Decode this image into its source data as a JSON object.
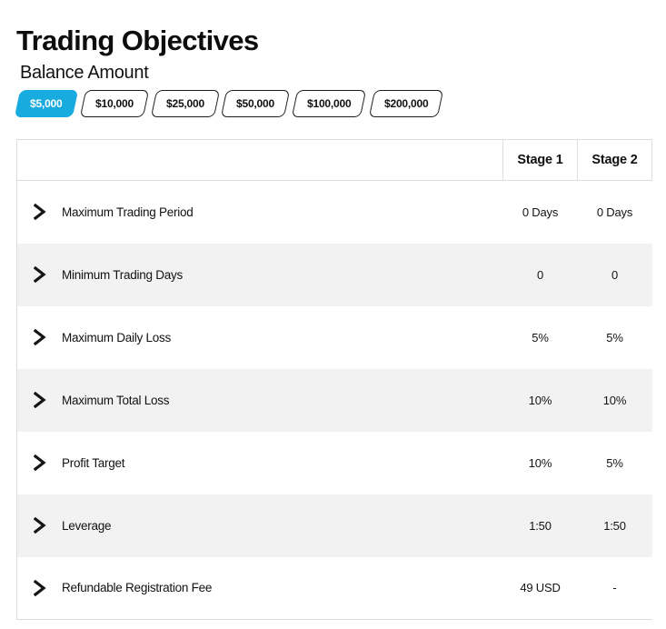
{
  "header": {
    "title": "Trading Objectives",
    "subtitle": "Balance Amount"
  },
  "theme": {
    "accent": "#18ABE0",
    "row_stripe": "#f2f2f2",
    "border": "#dddddd",
    "text": "#111111"
  },
  "balance_tabs": {
    "selected": "$5,000",
    "options": [
      {
        "label": "$5,000",
        "active": true
      },
      {
        "label": "$10,000",
        "active": false
      },
      {
        "label": "$25,000",
        "active": false
      },
      {
        "label": "$50,000",
        "active": false
      },
      {
        "label": "$100,000",
        "active": false
      },
      {
        "label": "$200,000",
        "active": false
      }
    ]
  },
  "table": {
    "columns": [
      {
        "key": "name",
        "label": ""
      },
      {
        "key": "stage1",
        "label": "Stage 1"
      },
      {
        "key": "stage2",
        "label": "Stage 2"
      }
    ],
    "expand_icon": "chevron-right-icon",
    "rows": [
      {
        "label": "Maximum Trading Period",
        "stage1": "0 Days",
        "stage2": "0 Days"
      },
      {
        "label": "Minimum Trading Days",
        "stage1": "0",
        "stage2": "0"
      },
      {
        "label": "Maximum Daily Loss",
        "stage1": "5%",
        "stage2": "5%"
      },
      {
        "label": "Maximum Total Loss",
        "stage1": "10%",
        "stage2": "10%"
      },
      {
        "label": "Profit Target",
        "stage1": "10%",
        "stage2": "5%"
      },
      {
        "label": "Leverage",
        "stage1": "1:50",
        "stage2": "1:50"
      },
      {
        "label": "Refundable Registration Fee",
        "stage1": "49 USD",
        "stage2": "-"
      }
    ]
  }
}
